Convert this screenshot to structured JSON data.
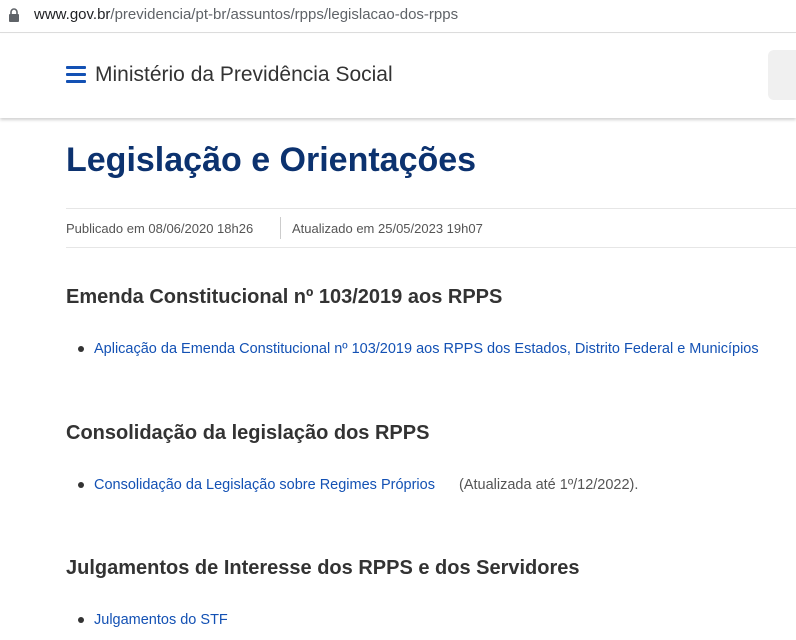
{
  "browser": {
    "url_domain": "www.gov.br",
    "url_path": "/previdencia/pt-br/assuntos/rpps/legislacao-dos-rpps",
    "lock_icon": "lock-icon"
  },
  "header": {
    "menu_icon": "hamburger-menu-icon",
    "site_title": "Ministério da Previdência Social",
    "brand_color": "#1351b4"
  },
  "main": {
    "page_title": "Legislação e Orientações",
    "published": "Publicado em 08/06/2020 18h26",
    "updated": "Atualizado em 25/05/2023 19h07",
    "sections": [
      {
        "title": "Emenda Constitucional nº 103/2019 aos RPPS",
        "items": [
          {
            "link": "Aplicação da Emenda Constitucional nº 103/2019 aos RPPS dos Estados, Distrito Federal e Municípios",
            "note": ""
          }
        ]
      },
      {
        "title": "Consolidação da legislação dos RPPS",
        "items": [
          {
            "link": "Consolidação da Legislação sobre Regimes Próprios",
            "note": "(Atualizada até 1º/12/2022)."
          }
        ]
      },
      {
        "title": "Julgamentos de Interesse dos RPPS e dos Servidores",
        "items": [
          {
            "link": "Julgamentos do STF",
            "note": ""
          }
        ]
      }
    ]
  },
  "colors": {
    "title": "#0c326f",
    "link": "#1351b4",
    "text": "#333333"
  }
}
